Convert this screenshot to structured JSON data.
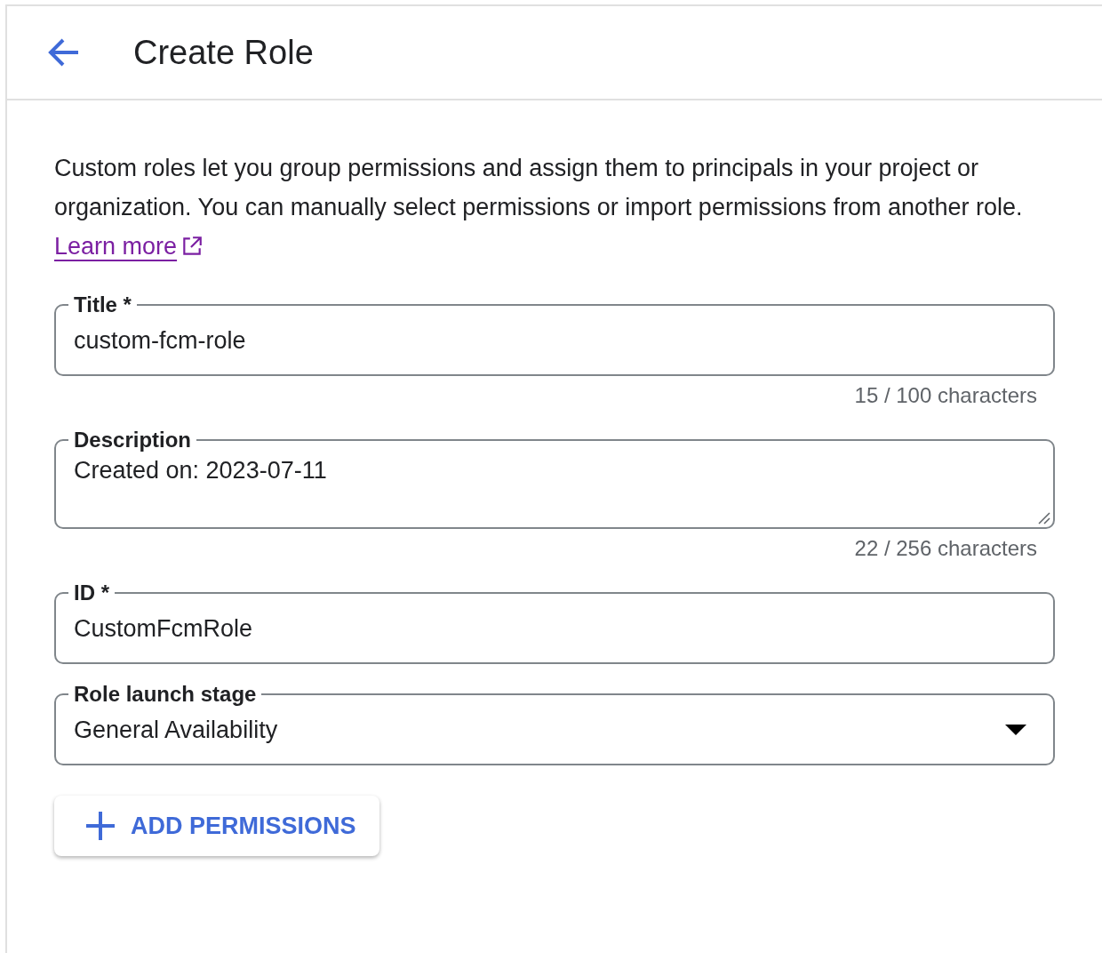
{
  "header": {
    "title": "Create Role"
  },
  "intro": {
    "text": "Custom roles let you group permissions and assign them to principals in your project or organization. You can manually select permissions or import permissions from another role.",
    "link": "Learn more"
  },
  "fields": [
    {
      "kind": "input",
      "label": "Title *",
      "value": "custom-fcm-role",
      "counter": "15 / 100 characters"
    },
    {
      "kind": "textarea",
      "label": "Description",
      "value": "Created on: 2023-07-11",
      "counter": "22 / 256 characters"
    },
    {
      "kind": "input",
      "label": "ID *",
      "value": "CustomFcmRole"
    },
    {
      "kind": "select",
      "label": "Role launch stage",
      "value": "General Availability"
    }
  ],
  "add_button": {
    "label": "ADD PERMISSIONS"
  }
}
